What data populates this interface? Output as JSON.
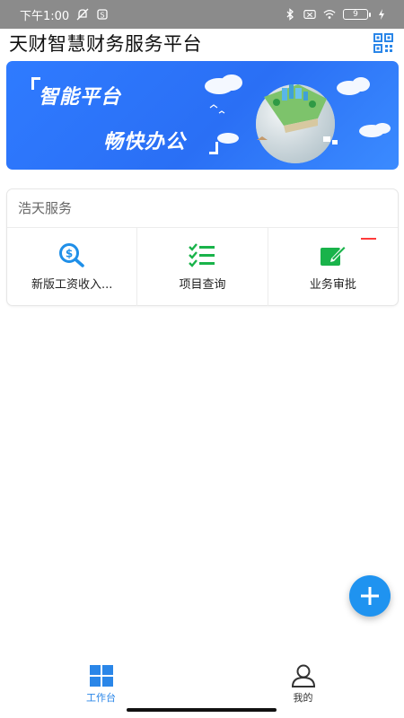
{
  "status_bar": {
    "time": "下午1:00",
    "battery": "9"
  },
  "header": {
    "title": "天财智慧财务服务平台"
  },
  "banner": {
    "line1": "智能平台",
    "line2": "畅快办公"
  },
  "services": {
    "title": "浩天服务",
    "items": [
      {
        "label": "新版工资收入...",
        "icon": "money-search-icon",
        "color": "#1f8fe8"
      },
      {
        "label": "项目查询",
        "icon": "checklist-icon",
        "color": "#19b34a"
      },
      {
        "label": "业务审批",
        "icon": "edit-approve-icon",
        "color": "#19b34a"
      }
    ]
  },
  "bottom_nav": {
    "items": [
      {
        "label": "工作台",
        "icon": "grid-icon",
        "active": true
      },
      {
        "label": "我的",
        "icon": "user-icon",
        "active": false
      }
    ]
  },
  "colors": {
    "accent": "#2a86e8",
    "banner": "#2f7bff",
    "green": "#19b34a",
    "badge": "#ff3b3b"
  }
}
